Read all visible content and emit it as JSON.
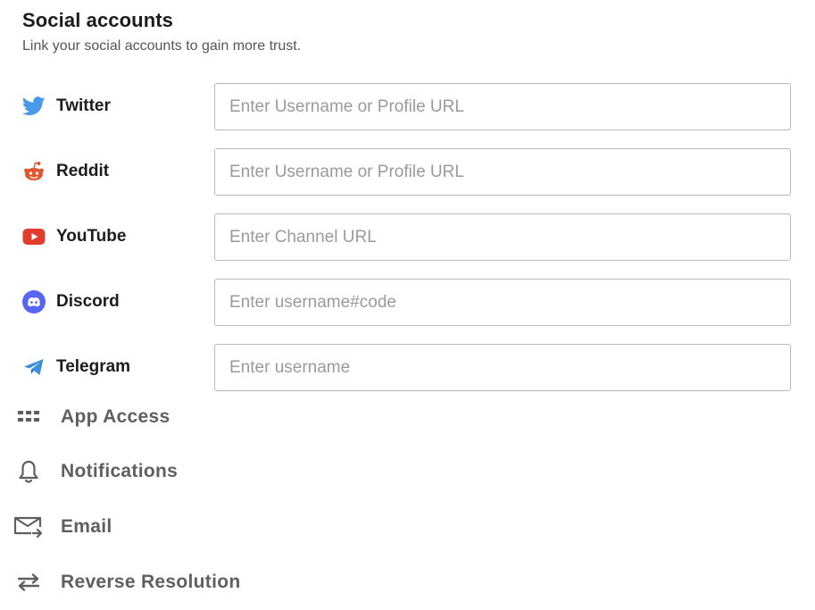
{
  "section": {
    "title": "Social accounts",
    "subtitle": "Link your social accounts to gain more trust."
  },
  "socials": [
    {
      "name": "Twitter",
      "icon": "twitter-icon",
      "color": "#4A99E9",
      "placeholder": "Enter Username or Profile URL"
    },
    {
      "name": "Reddit",
      "icon": "reddit-icon",
      "color": "#E0562E",
      "placeholder": "Enter Username or Profile URL"
    },
    {
      "name": "YouTube",
      "icon": "youtube-icon",
      "color": "#E33B2E",
      "placeholder": "Enter Channel URL"
    },
    {
      "name": "Discord",
      "icon": "discord-icon",
      "color": "#5865F2",
      "placeholder": "Enter username#code"
    },
    {
      "name": "Telegram",
      "icon": "telegram-icon",
      "color": "#3A8FD8",
      "placeholder": "Enter username"
    }
  ],
  "menu": [
    {
      "label": "App Access",
      "icon": "grid-icon"
    },
    {
      "label": "Notifications",
      "icon": "bell-icon"
    },
    {
      "label": "Email",
      "icon": "mail-icon"
    },
    {
      "label": "Reverse Resolution",
      "icon": "swap-arrows-icon"
    }
  ]
}
